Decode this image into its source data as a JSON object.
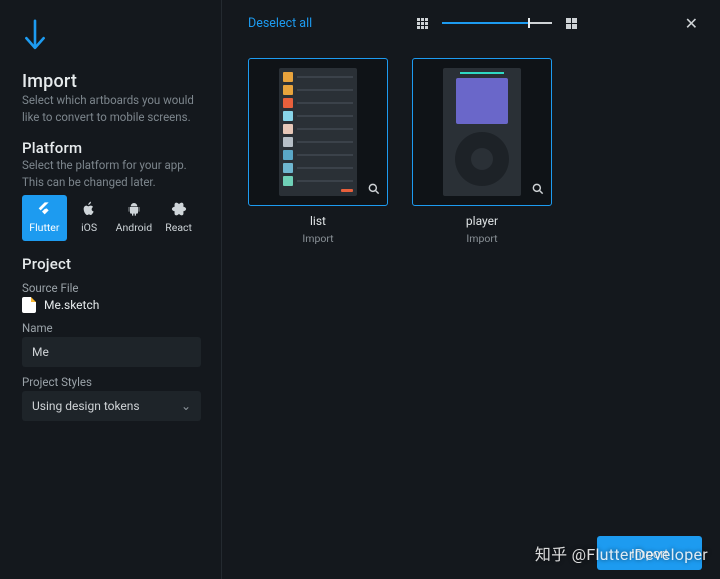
{
  "sidebar": {
    "import": {
      "title": "Import",
      "desc": "Select which artboards you would like to convert to mobile screens."
    },
    "platform": {
      "title": "Platform",
      "desc": "Select the platform for your app. This can be changed later.",
      "options": [
        "Flutter",
        "iOS",
        "Android",
        "React"
      ],
      "selected": "Flutter"
    },
    "project": {
      "title": "Project",
      "source_label": "Source File",
      "source_file": "Me.sketch",
      "name_label": "Name",
      "name_value": "Me",
      "styles_label": "Project Styles",
      "styles_value": "Using design tokens"
    }
  },
  "topbar": {
    "deselect": "Deselect all",
    "zoom_percent": 78
  },
  "artboards": [
    {
      "title": "list",
      "sub": "Import"
    },
    {
      "title": "player",
      "sub": "Import"
    }
  ],
  "thumb1_swatches": [
    "#e8a33c",
    "#e8a33c",
    "#e8603c",
    "#88d4e8",
    "#e7c7b8",
    "#b6bfc7",
    "#5aa7c7",
    "#6fb7d0",
    "#6fd0b7"
  ],
  "footer": {
    "primary": "Import"
  },
  "watermark": "知乎 @FlutterDeveloper"
}
